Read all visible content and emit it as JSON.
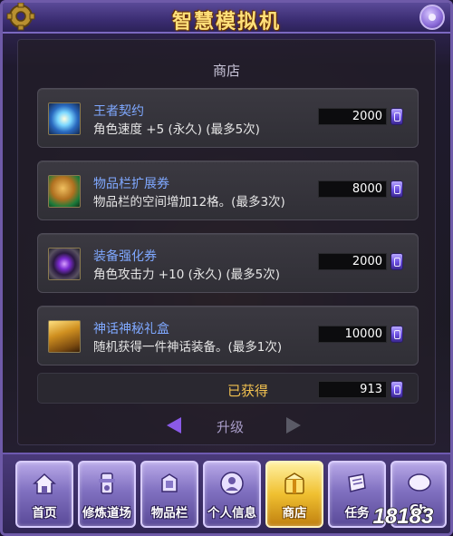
{
  "window": {
    "title": "智慧模拟机"
  },
  "shop": {
    "heading": "商店",
    "items": [
      {
        "name": "王者契约",
        "desc": "角色速度 +5 (永久) (最多5次)",
        "price": "2000",
        "icon": "king-contract-icon"
      },
      {
        "name": "物品栏扩展券",
        "desc": "物品栏的空间增加12格。(最多3次)",
        "price": "8000",
        "icon": "inventory-expand-ticket-icon"
      },
      {
        "name": "装备强化券",
        "desc": "角色攻击力 +10 (永久) (最多5次)",
        "price": "2000",
        "icon": "equipment-enhance-ticket-icon"
      },
      {
        "name": "神话神秘礼盒",
        "desc": "随机获得一件神话装备。(最多1次)",
        "price": "10000",
        "icon": "mythic-mystery-box-icon"
      }
    ],
    "obtained_label": "已获得",
    "obtained_value": "913",
    "currency_icon": "purple-gem-icon"
  },
  "pager": {
    "label": "升级"
  },
  "tabs": [
    {
      "label": "首页",
      "icon": "home-icon",
      "active": false
    },
    {
      "label": "修炼道场",
      "icon": "training-hall-icon",
      "active": false
    },
    {
      "label": "物品栏",
      "icon": "inventory-icon",
      "active": false
    },
    {
      "label": "个人信息",
      "icon": "profile-icon",
      "active": false
    },
    {
      "label": "商店",
      "icon": "shop-icon",
      "active": true
    },
    {
      "label": "任务",
      "icon": "quest-scroll-icon",
      "active": false
    },
    {
      "label": "Ch",
      "icon": "chat-icon",
      "active": false
    }
  ],
  "watermark": "18183",
  "colors": {
    "frame": "#6e5aa8",
    "title": "#ffe07a",
    "item_name": "#7fa8ff",
    "obtained_label": "#f0c050",
    "active_tab": "#f0c030"
  }
}
